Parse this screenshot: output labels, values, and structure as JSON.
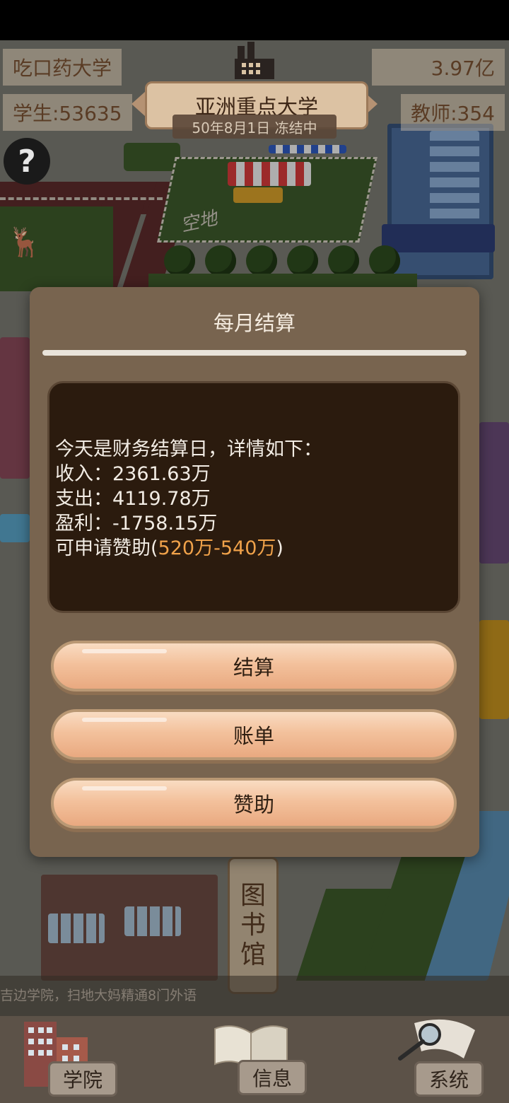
{
  "header": {
    "school_name": "吃口药大学",
    "funds": "3.97亿",
    "title": "亚洲重点大学",
    "students": "学生:53635",
    "teachers": "教师:354",
    "date_status": "50年8月1日 冻结中",
    "help_icon": "question-mark-icon"
  },
  "map": {
    "lot_label": "空地",
    "library_sign": [
      "图",
      "书",
      "馆"
    ],
    "ticker": "吉边学院，扫地大妈精通8门外语"
  },
  "dialog": {
    "title": "每月结算",
    "report": {
      "intro": "今天是财务结算日，详情如下：",
      "income": "收入：2361.63万",
      "expense": "支出：4119.78万",
      "profit": "盈利：-1758.15万",
      "sponsor_prefix": "可申请赞助(",
      "sponsor_min": "520万",
      "sponsor_sep": "-",
      "sponsor_max": "540万",
      "sponsor_suffix": ")"
    },
    "buttons": {
      "settle": "结算",
      "bill": "账单",
      "sponsor": "赞助"
    }
  },
  "bottom_nav": {
    "college": "学院",
    "info": "信息",
    "system": "系统"
  },
  "colors": {
    "highlight": "#f0a24a",
    "dialog_bg": "#78644f",
    "report_bg": "#2b1b0e"
  }
}
